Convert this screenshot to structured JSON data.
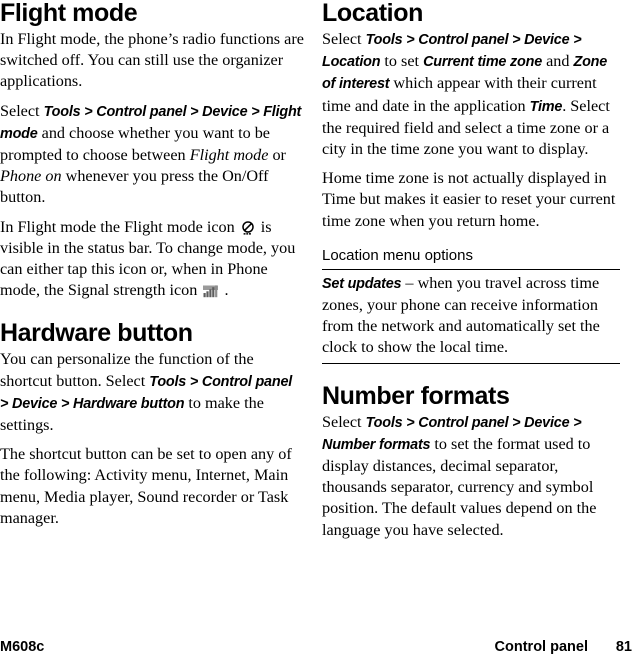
{
  "footer": {
    "model": "M608c",
    "chapter": "Control panel",
    "page_number": "81"
  },
  "left_column": {
    "section1": {
      "title": "Flight mode",
      "p1": "In Flight mode, the phone’s radio functions are switched off. You can still use the organizer applications.",
      "p2_lead": "Select ",
      "p2_path": "Tools > Control panel > Device > Flight mode",
      "p2_mid": " and choose whether you want to be prompted to choose between ",
      "p2_em1": "Flight mode",
      "p2_mid2": " or ",
      "p2_em2": "Phone on",
      "p2_tail": " whenever you press the On/Off button.",
      "p3_lead": "In Flight mode the Flight mode icon ",
      "p3_icon1": "flight-mode-icon",
      "p3_mid": " is visible in the status bar. To change mode, you can either tap this icon or, when in Phone mode, the Signal strength icon ",
      "p3_icon2": "signal-strength-icon",
      "p3_tail": " ."
    },
    "section2": {
      "title": "Hardware button",
      "p1_lead": "You can personalize the function of the shortcut button. Select ",
      "p1_path": "Tools > Control panel > Device > Hardware button",
      "p1_tail": " to make the settings.",
      "p2": "The shortcut button can be set to open any of the following: Activity menu, Internet, Main menu, Media player, Sound recorder or Task manager."
    }
  },
  "right_column": {
    "section1": {
      "title": "Location",
      "p1_lead": "Select ",
      "p1_path": "Tools > Control panel > Device > Location",
      "p1_mid": " to set ",
      "p1_path2": "Current time zone",
      "p1_mid2": " and ",
      "p1_path3": "Zone of interest",
      "p1_mid3": " which appear with their current time and date in the application ",
      "p1_path4": "Time",
      "p1_tail": ". Select the required field and select a time zone or a city in the time zone you want to display.",
      "p2": "Home time zone is not actually displayed in Time but makes it easier to reset your current time zone when you return home.",
      "options_heading": "Location menu options",
      "option_term": "Set updates",
      "option_desc": " – when you travel across time zones, your phone can receive information from the network and automatically set the clock to show the local time."
    },
    "section2": {
      "title": "Number formats",
      "p1_lead": "Select ",
      "p1_path": "Tools > Control panel > Device > Number formats",
      "p1_tail": " to set the format used to display distances, decimal separator, thousands separator, currency and symbol position. The default values depend on the language you have selected."
    }
  },
  "colors": {
    "text": "#000000",
    "background": "#ffffff",
    "rule": "#000000",
    "icon_gray": "#808080"
  }
}
